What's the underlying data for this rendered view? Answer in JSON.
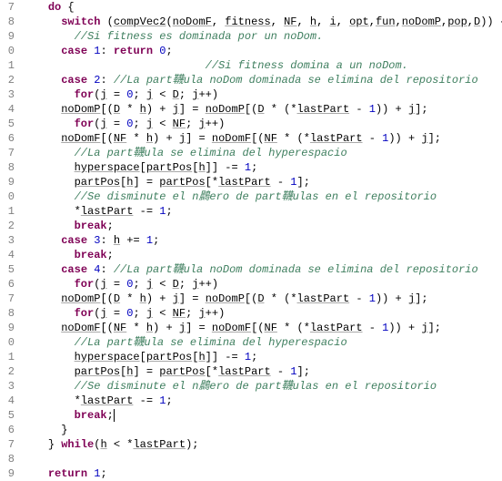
{
  "gutter": {
    "start": 7,
    "end": 39
  },
  "caret_line_index": 28,
  "lines": [
    {
      "indent": 2,
      "tokens": [
        {
          "t": "do",
          "c": "kw"
        },
        {
          "t": " {",
          "c": ""
        }
      ]
    },
    {
      "indent": 3,
      "tokens": [
        {
          "t": "switch",
          "c": "kw"
        },
        {
          "t": " (",
          "c": ""
        },
        {
          "t": "compVec2",
          "c": "id"
        },
        {
          "t": "(",
          "c": ""
        },
        {
          "t": "noDomF",
          "c": "id"
        },
        {
          "t": ", ",
          "c": ""
        },
        {
          "t": "fitness",
          "c": "id"
        },
        {
          "t": ", ",
          "c": ""
        },
        {
          "t": "NF",
          "c": "id"
        },
        {
          "t": ", ",
          "c": ""
        },
        {
          "t": "h",
          "c": "id"
        },
        {
          "t": ", ",
          "c": ""
        },
        {
          "t": "i",
          "c": "id"
        },
        {
          "t": ", ",
          "c": ""
        },
        {
          "t": "opt",
          "c": "id"
        },
        {
          "t": ",",
          "c": ""
        },
        {
          "t": "fun",
          "c": "id"
        },
        {
          "t": ",",
          "c": ""
        },
        {
          "t": "noDomP",
          "c": "id"
        },
        {
          "t": ",",
          "c": ""
        },
        {
          "t": "pop",
          "c": "id"
        },
        {
          "t": ",",
          "c": ""
        },
        {
          "t": "D",
          "c": "id"
        },
        {
          "t": ")) {",
          "c": ""
        }
      ]
    },
    {
      "indent": 4,
      "tokens": [
        {
          "t": "//Si fitness es dominada por un noDom.",
          "c": "cm"
        }
      ]
    },
    {
      "indent": 3,
      "tokens": [
        {
          "t": "case",
          "c": "kw"
        },
        {
          "t": " ",
          "c": ""
        },
        {
          "t": "1",
          "c": "num"
        },
        {
          "t": ": ",
          "c": ""
        },
        {
          "t": "return",
          "c": "kw"
        },
        {
          "t": " ",
          "c": ""
        },
        {
          "t": "0",
          "c": "num"
        },
        {
          "t": ";",
          "c": ""
        }
      ]
    },
    {
      "indent": 14,
      "tokens": [
        {
          "t": "//Si fitness domina a un noDom.",
          "c": "cm"
        }
      ]
    },
    {
      "indent": 3,
      "tokens": [
        {
          "t": "case",
          "c": "kw"
        },
        {
          "t": " ",
          "c": ""
        },
        {
          "t": "2",
          "c": "num"
        },
        {
          "t": ": ",
          "c": ""
        },
        {
          "t": "//La part韈ula noDom dominada se elimina del repositorio",
          "c": "cm"
        }
      ]
    },
    {
      "indent": 4,
      "tokens": [
        {
          "t": "for",
          "c": "kw"
        },
        {
          "t": "(",
          "c": ""
        },
        {
          "t": "j",
          "c": "id"
        },
        {
          "t": " = ",
          "c": ""
        },
        {
          "t": "0",
          "c": "num"
        },
        {
          "t": "; ",
          "c": ""
        },
        {
          "t": "j",
          "c": "id"
        },
        {
          "t": " < ",
          "c": ""
        },
        {
          "t": "D",
          "c": "id"
        },
        {
          "t": "; ",
          "c": ""
        },
        {
          "t": "j",
          "c": "id"
        },
        {
          "t": "++)",
          "c": ""
        }
      ]
    },
    {
      "indent": 3,
      "tokens": [
        {
          "t": "noDomP",
          "c": "id"
        },
        {
          "t": "[(",
          "c": ""
        },
        {
          "t": "D",
          "c": "id"
        },
        {
          "t": " * ",
          "c": ""
        },
        {
          "t": "h",
          "c": "id"
        },
        {
          "t": ") + ",
          "c": ""
        },
        {
          "t": "j",
          "c": "id"
        },
        {
          "t": "] = ",
          "c": ""
        },
        {
          "t": "noDomP",
          "c": "id"
        },
        {
          "t": "[(",
          "c": ""
        },
        {
          "t": "D",
          "c": "id"
        },
        {
          "t": " * (*",
          "c": ""
        },
        {
          "t": "lastPart",
          "c": "id"
        },
        {
          "t": " - ",
          "c": ""
        },
        {
          "t": "1",
          "c": "num"
        },
        {
          "t": ")) + ",
          "c": ""
        },
        {
          "t": "j",
          "c": "id"
        },
        {
          "t": "];",
          "c": ""
        }
      ]
    },
    {
      "indent": 4,
      "tokens": [
        {
          "t": "for",
          "c": "kw"
        },
        {
          "t": "(",
          "c": ""
        },
        {
          "t": "j",
          "c": "id"
        },
        {
          "t": " = ",
          "c": ""
        },
        {
          "t": "0",
          "c": "num"
        },
        {
          "t": "; ",
          "c": ""
        },
        {
          "t": "j",
          "c": "id"
        },
        {
          "t": " < ",
          "c": ""
        },
        {
          "t": "NF",
          "c": "id"
        },
        {
          "t": "; ",
          "c": ""
        },
        {
          "t": "j",
          "c": "id"
        },
        {
          "t": "++)",
          "c": ""
        }
      ]
    },
    {
      "indent": 3,
      "tokens": [
        {
          "t": "noDomF",
          "c": "id"
        },
        {
          "t": "[(",
          "c": ""
        },
        {
          "t": "NF",
          "c": "id"
        },
        {
          "t": " * ",
          "c": ""
        },
        {
          "t": "h",
          "c": "id"
        },
        {
          "t": ") + ",
          "c": ""
        },
        {
          "t": "j",
          "c": "id"
        },
        {
          "t": "] = ",
          "c": ""
        },
        {
          "t": "noDomF",
          "c": "id"
        },
        {
          "t": "[(",
          "c": ""
        },
        {
          "t": "NF",
          "c": "id"
        },
        {
          "t": " * (*",
          "c": ""
        },
        {
          "t": "lastPart",
          "c": "id"
        },
        {
          "t": " - ",
          "c": ""
        },
        {
          "t": "1",
          "c": "num"
        },
        {
          "t": ")) + ",
          "c": ""
        },
        {
          "t": "j",
          "c": "id"
        },
        {
          "t": "];",
          "c": ""
        }
      ]
    },
    {
      "indent": 4,
      "tokens": [
        {
          "t": "//La part韈ula se elimina del hyperespacio",
          "c": "cm"
        }
      ]
    },
    {
      "indent": 4,
      "tokens": [
        {
          "t": "hyperspace",
          "c": "id"
        },
        {
          "t": "[",
          "c": ""
        },
        {
          "t": "partPos",
          "c": "id"
        },
        {
          "t": "[",
          "c": ""
        },
        {
          "t": "h",
          "c": "id"
        },
        {
          "t": "]] -= ",
          "c": ""
        },
        {
          "t": "1",
          "c": "num"
        },
        {
          "t": ";",
          "c": ""
        }
      ]
    },
    {
      "indent": 4,
      "tokens": [
        {
          "t": "partPos",
          "c": "id"
        },
        {
          "t": "[",
          "c": ""
        },
        {
          "t": "h",
          "c": "id"
        },
        {
          "t": "] = ",
          "c": ""
        },
        {
          "t": "partPos",
          "c": "id"
        },
        {
          "t": "[*",
          "c": ""
        },
        {
          "t": "lastPart",
          "c": "id"
        },
        {
          "t": " - ",
          "c": ""
        },
        {
          "t": "1",
          "c": "num"
        },
        {
          "t": "];",
          "c": ""
        }
      ]
    },
    {
      "indent": 4,
      "tokens": [
        {
          "t": "//Se disminute el n鷐ero de part韈ulas en el repositorio",
          "c": "cm"
        }
      ]
    },
    {
      "indent": 4,
      "tokens": [
        {
          "t": "*",
          "c": ""
        },
        {
          "t": "lastPart",
          "c": "id"
        },
        {
          "t": " -= ",
          "c": ""
        },
        {
          "t": "1",
          "c": "num"
        },
        {
          "t": ";",
          "c": ""
        }
      ]
    },
    {
      "indent": 4,
      "tokens": [
        {
          "t": "break",
          "c": "kw"
        },
        {
          "t": ";",
          "c": ""
        }
      ]
    },
    {
      "indent": 3,
      "tokens": [
        {
          "t": "case",
          "c": "kw"
        },
        {
          "t": " ",
          "c": ""
        },
        {
          "t": "3",
          "c": "num"
        },
        {
          "t": ": ",
          "c": ""
        },
        {
          "t": "h",
          "c": "id"
        },
        {
          "t": " += ",
          "c": ""
        },
        {
          "t": "1",
          "c": "num"
        },
        {
          "t": ";",
          "c": ""
        }
      ]
    },
    {
      "indent": 4,
      "tokens": [
        {
          "t": "break",
          "c": "kw"
        },
        {
          "t": ";",
          "c": ""
        }
      ]
    },
    {
      "indent": 3,
      "tokens": [
        {
          "t": "case",
          "c": "kw"
        },
        {
          "t": " ",
          "c": ""
        },
        {
          "t": "4",
          "c": "num"
        },
        {
          "t": ": ",
          "c": ""
        },
        {
          "t": "//La part韈ula noDom dominada se elimina del repositorio",
          "c": "cm"
        }
      ]
    },
    {
      "indent": 4,
      "tokens": [
        {
          "t": "for",
          "c": "kw"
        },
        {
          "t": "(",
          "c": ""
        },
        {
          "t": "j",
          "c": "id"
        },
        {
          "t": " = ",
          "c": ""
        },
        {
          "t": "0",
          "c": "num"
        },
        {
          "t": "; ",
          "c": ""
        },
        {
          "t": "j",
          "c": "id"
        },
        {
          "t": " < ",
          "c": ""
        },
        {
          "t": "D",
          "c": "id"
        },
        {
          "t": "; ",
          "c": ""
        },
        {
          "t": "j",
          "c": "id"
        },
        {
          "t": "++)",
          "c": ""
        }
      ]
    },
    {
      "indent": 3,
      "tokens": [
        {
          "t": "noDomP",
          "c": "id"
        },
        {
          "t": "[(",
          "c": ""
        },
        {
          "t": "D",
          "c": "id"
        },
        {
          "t": " * ",
          "c": ""
        },
        {
          "t": "h",
          "c": "id"
        },
        {
          "t": ") + ",
          "c": ""
        },
        {
          "t": "j",
          "c": "id"
        },
        {
          "t": "] = ",
          "c": ""
        },
        {
          "t": "noDomP",
          "c": "id"
        },
        {
          "t": "[(",
          "c": ""
        },
        {
          "t": "D",
          "c": "id"
        },
        {
          "t": " * (*",
          "c": ""
        },
        {
          "t": "lastPart",
          "c": "id"
        },
        {
          "t": " - ",
          "c": ""
        },
        {
          "t": "1",
          "c": "num"
        },
        {
          "t": ")) + ",
          "c": ""
        },
        {
          "t": "j",
          "c": "id"
        },
        {
          "t": "];",
          "c": ""
        }
      ]
    },
    {
      "indent": 4,
      "tokens": [
        {
          "t": "for",
          "c": "kw"
        },
        {
          "t": "(",
          "c": ""
        },
        {
          "t": "j",
          "c": "id"
        },
        {
          "t": " = ",
          "c": ""
        },
        {
          "t": "0",
          "c": "num"
        },
        {
          "t": "; ",
          "c": ""
        },
        {
          "t": "j",
          "c": "id"
        },
        {
          "t": " < ",
          "c": ""
        },
        {
          "t": "NF",
          "c": "id"
        },
        {
          "t": "; ",
          "c": ""
        },
        {
          "t": "j",
          "c": "id"
        },
        {
          "t": "++)",
          "c": ""
        }
      ]
    },
    {
      "indent": 3,
      "tokens": [
        {
          "t": "noDomF",
          "c": "id"
        },
        {
          "t": "[(",
          "c": ""
        },
        {
          "t": "NF",
          "c": "id"
        },
        {
          "t": " * ",
          "c": ""
        },
        {
          "t": "h",
          "c": "id"
        },
        {
          "t": ") + ",
          "c": ""
        },
        {
          "t": "j",
          "c": "id"
        },
        {
          "t": "] = ",
          "c": ""
        },
        {
          "t": "noDomF",
          "c": "id"
        },
        {
          "t": "[(",
          "c": ""
        },
        {
          "t": "NF",
          "c": "id"
        },
        {
          "t": " * (*",
          "c": ""
        },
        {
          "t": "lastPart",
          "c": "id"
        },
        {
          "t": " - ",
          "c": ""
        },
        {
          "t": "1",
          "c": "num"
        },
        {
          "t": ")) + ",
          "c": ""
        },
        {
          "t": "j",
          "c": "id"
        },
        {
          "t": "];",
          "c": ""
        }
      ]
    },
    {
      "indent": 4,
      "tokens": [
        {
          "t": "//La part韈ula se elimina del hyperespacio",
          "c": "cm"
        }
      ]
    },
    {
      "indent": 4,
      "tokens": [
        {
          "t": "hyperspace",
          "c": "id"
        },
        {
          "t": "[",
          "c": ""
        },
        {
          "t": "partPos",
          "c": "id"
        },
        {
          "t": "[",
          "c": ""
        },
        {
          "t": "h",
          "c": "id"
        },
        {
          "t": "]] -= ",
          "c": ""
        },
        {
          "t": "1",
          "c": "num"
        },
        {
          "t": ";",
          "c": ""
        }
      ]
    },
    {
      "indent": 4,
      "tokens": [
        {
          "t": "partPos",
          "c": "id"
        },
        {
          "t": "[",
          "c": ""
        },
        {
          "t": "h",
          "c": "id"
        },
        {
          "t": "] = ",
          "c": ""
        },
        {
          "t": "partPos",
          "c": "id"
        },
        {
          "t": "[*",
          "c": ""
        },
        {
          "t": "lastPart",
          "c": "id"
        },
        {
          "t": " - ",
          "c": ""
        },
        {
          "t": "1",
          "c": "num"
        },
        {
          "t": "];",
          "c": ""
        }
      ]
    },
    {
      "indent": 4,
      "tokens": [
        {
          "t": "//Se disminute el n鷐ero de part韈ulas en el repositorio",
          "c": "cm"
        }
      ]
    },
    {
      "indent": 4,
      "tokens": [
        {
          "t": "*",
          "c": ""
        },
        {
          "t": "lastPart",
          "c": "id"
        },
        {
          "t": " -= ",
          "c": ""
        },
        {
          "t": "1",
          "c": "num"
        },
        {
          "t": ";",
          "c": ""
        }
      ]
    },
    {
      "indent": 4,
      "tokens": [
        {
          "t": "break",
          "c": "kw"
        },
        {
          "t": ";",
          "c": ""
        }
      ]
    },
    {
      "indent": 3,
      "tokens": [
        {
          "t": "}",
          "c": ""
        }
      ]
    },
    {
      "indent": 2,
      "tokens": [
        {
          "t": "} ",
          "c": ""
        },
        {
          "t": "while",
          "c": "kw"
        },
        {
          "t": "(",
          "c": ""
        },
        {
          "t": "h",
          "c": "id"
        },
        {
          "t": " < *",
          "c": ""
        },
        {
          "t": "lastPart",
          "c": "id"
        },
        {
          "t": ");",
          "c": ""
        }
      ]
    },
    {
      "indent": 0,
      "tokens": [
        {
          "t": "",
          "c": ""
        }
      ]
    },
    {
      "indent": 2,
      "tokens": [
        {
          "t": "return",
          "c": "kw"
        },
        {
          "t": " ",
          "c": ""
        },
        {
          "t": "1",
          "c": "num"
        },
        {
          "t": ";",
          "c": ""
        }
      ]
    }
  ]
}
